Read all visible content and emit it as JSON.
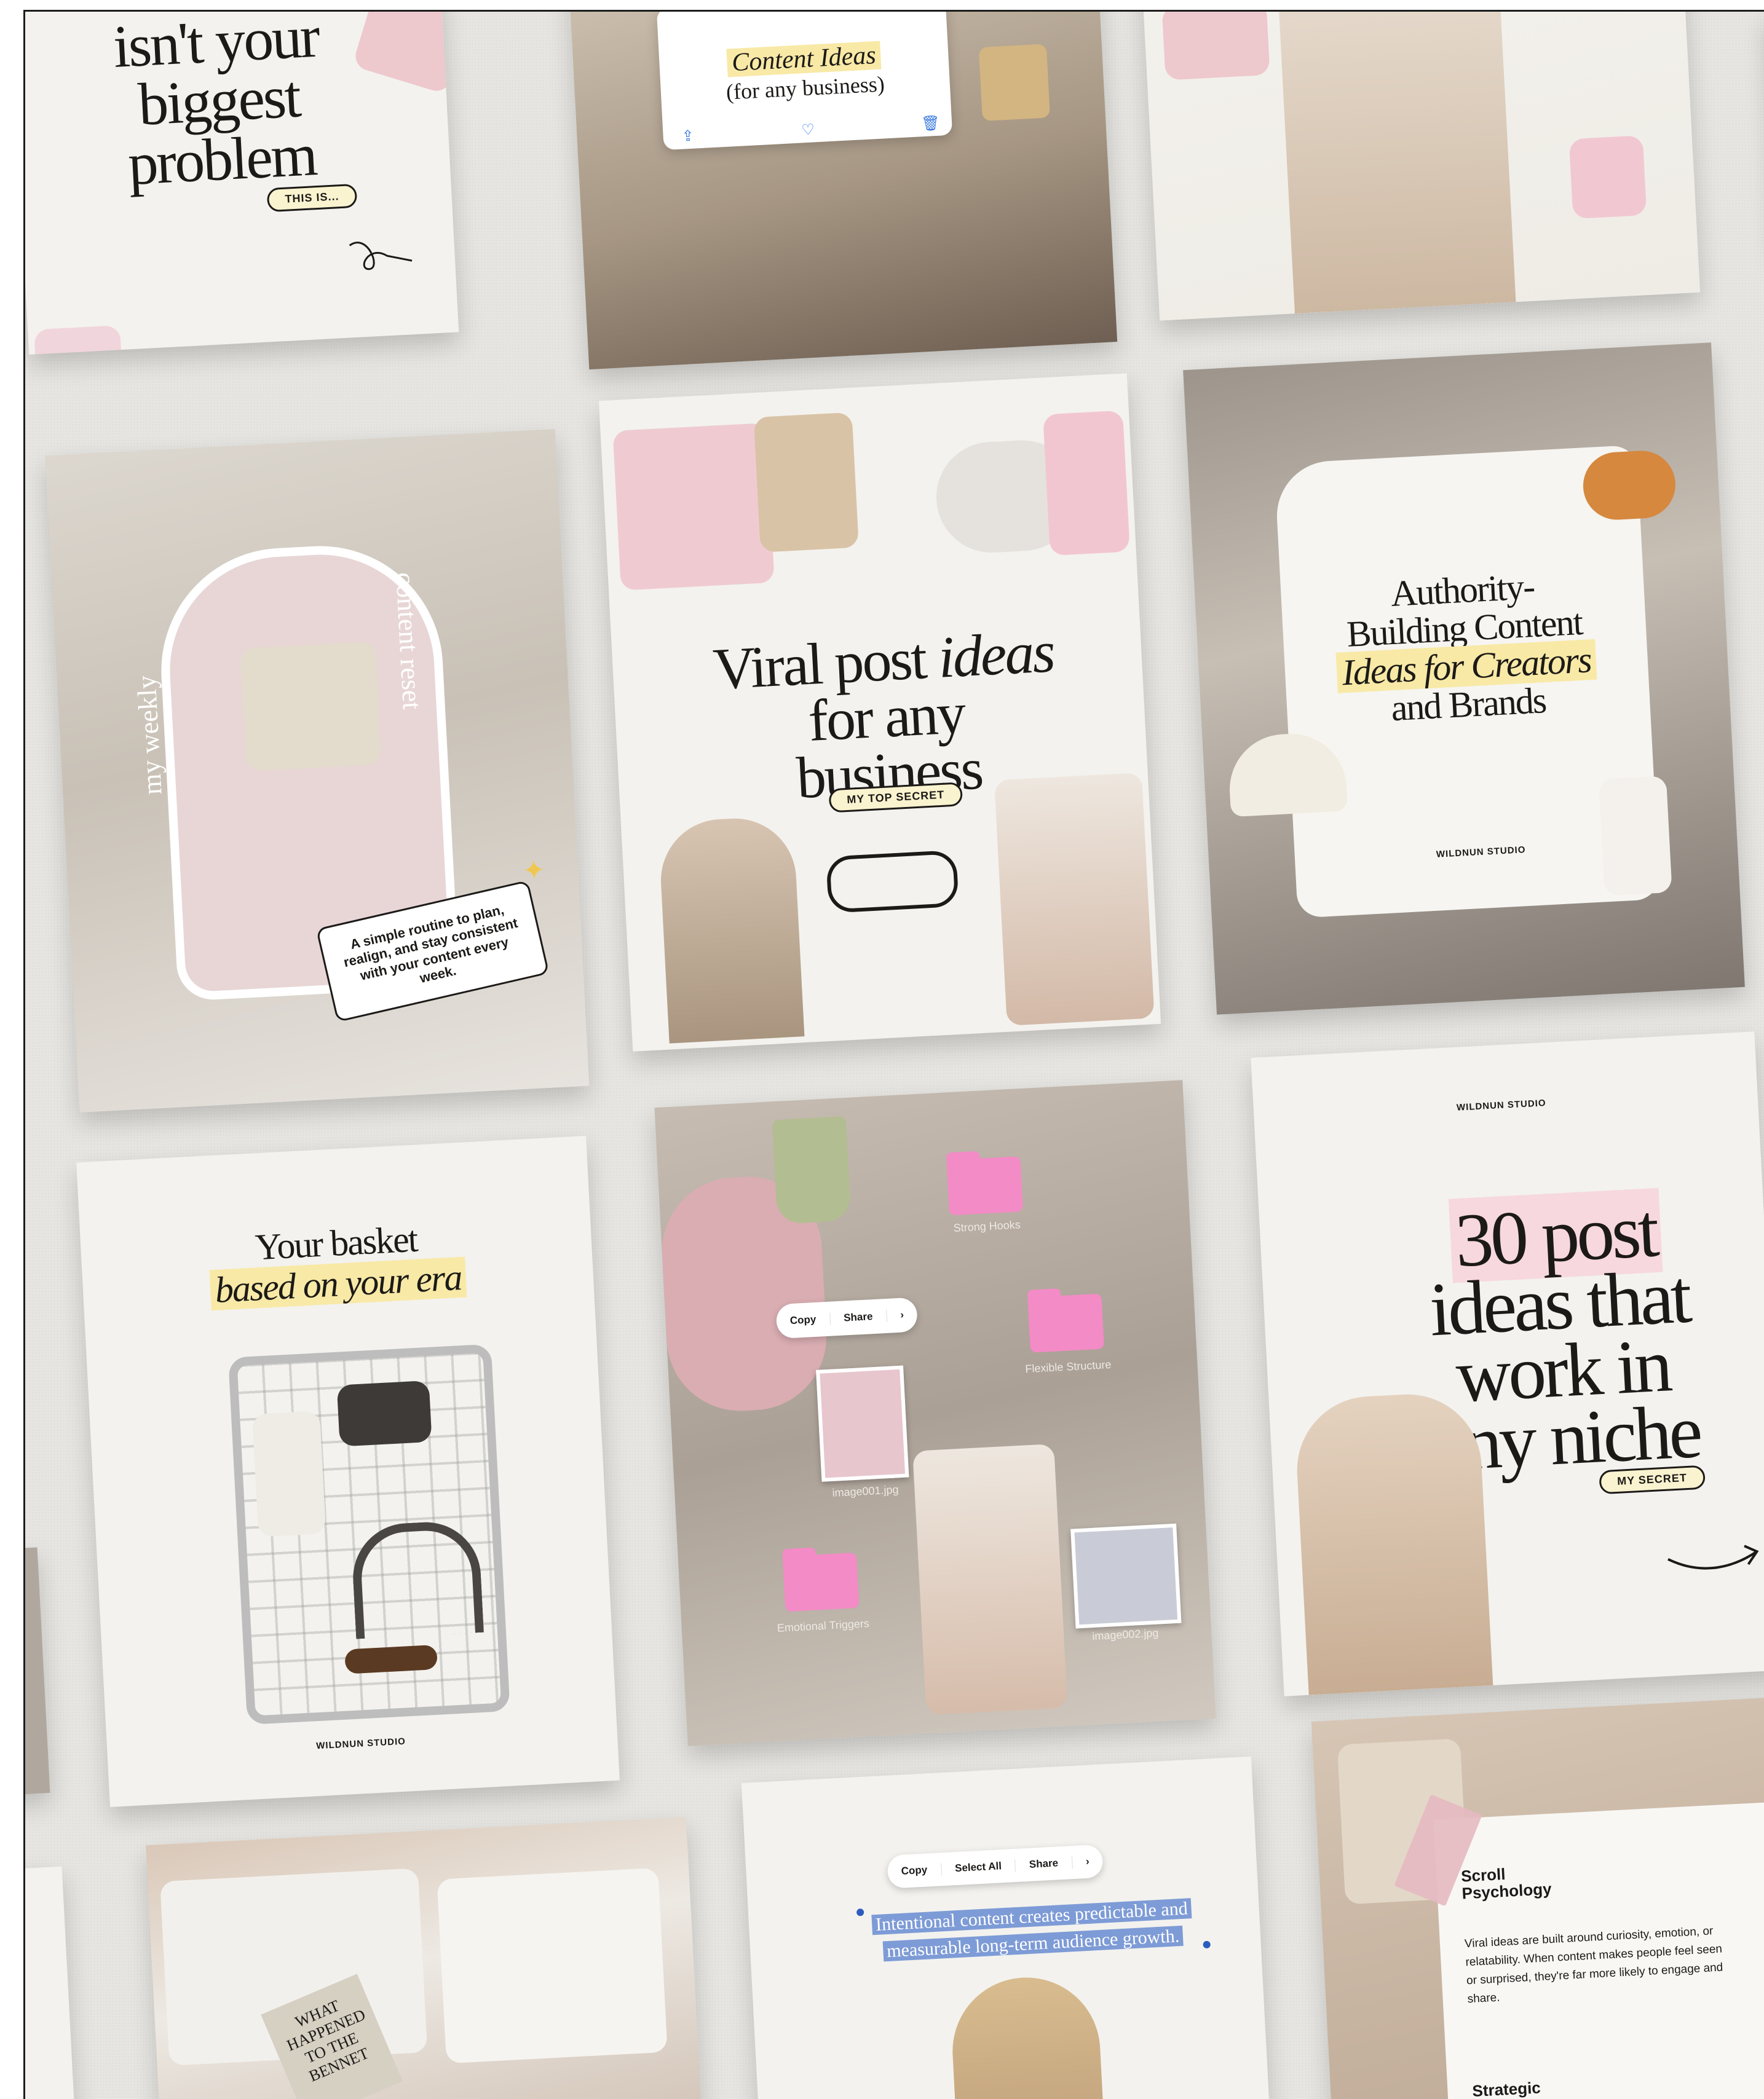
{
  "cards": {
    "c1": {
      "lines": [
        "isn't your",
        "biggest",
        "problem"
      ],
      "badge": "THIS IS..."
    },
    "c2": {
      "line1": "Content Ideas",
      "line2": "(for any business)"
    },
    "c4": {
      "left": "my weekly",
      "right": "content reset",
      "note": "A simple routine to plan, realign, and stay consistent with your content every week."
    },
    "c5": {
      "line1a": "Viral post ",
      "line1b": "ideas",
      "line2": "for any business",
      "badge": "MY TOP SECRET"
    },
    "c6": {
      "line1": "Authority-",
      "line2": "Building Content",
      "line3": "Ideas for Creators",
      "line4": "and Brands",
      "brand": "WILDNUN STUDIO"
    },
    "c7": {
      "line1": "Your basket",
      "line2": "based on your era",
      "brand": "WILDNUN STUDIO"
    },
    "c8": {
      "toolbar": [
        "Copy",
        "Share"
      ],
      "folders": [
        "Strong Hooks",
        "Flexible Structure",
        "Emotional Triggers"
      ],
      "files": [
        "image001.jpg",
        "image002.jpg"
      ]
    },
    "c9": {
      "brand": "WILDNUN STUDIO",
      "lines": [
        "30 post",
        "ideas that",
        "work in",
        "any niche"
      ],
      "badge": "MY SECRET"
    },
    "c11": {
      "toolbar": [
        "Copy",
        "Select All",
        "Share"
      ],
      "selected": [
        "Intentional content creates predictable and",
        "measurable long-term audience growth."
      ]
    },
    "c12": {
      "title": "Scroll Psychology",
      "body": "Viral ideas are built around curiosity, emotion, or relatability. When content makes people feel seen or surprised, they're far more likely to engage and share.",
      "next": "Strategic Structure"
    },
    "c10": {
      "book": "WHAT HAPPENED TO THE BENNET"
    }
  },
  "colors": {
    "background": "#e6e5e1",
    "card": "#f3f2ee",
    "highlight": "#f8e9a6",
    "pink": "#f38bc6"
  }
}
